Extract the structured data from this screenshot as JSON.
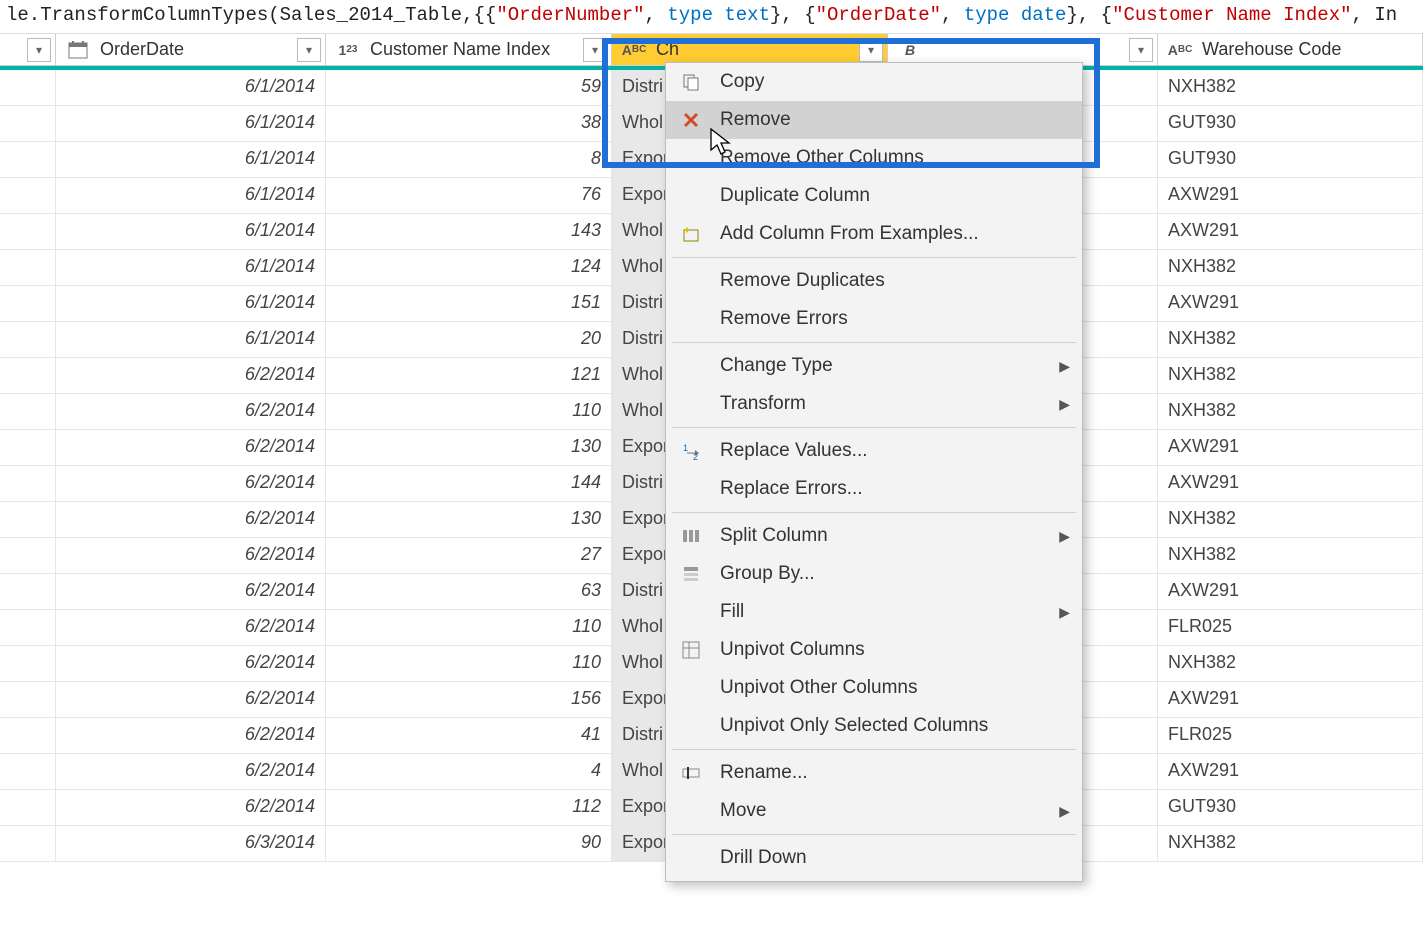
{
  "formula": {
    "prefix": "le.TransformColumnTypes(",
    "table": "Sales_2014_Table",
    "field1": "\"OrderNumber\"",
    "type_kw": "type",
    "type1": "text",
    "field2": "\"OrderDate\"",
    "type2": "date",
    "field3": "\"Customer Name Index\"",
    "tail": ", In"
  },
  "columns": [
    {
      "label": "",
      "type": "none"
    },
    {
      "label": "OrderDate",
      "type": "date"
    },
    {
      "label": "Customer Name Index",
      "type": "number"
    },
    {
      "label": "Ch",
      "type": "text",
      "selected": true
    },
    {
      "label": " ",
      "type": "text"
    },
    {
      "label": "Warehouse Code",
      "type": "text"
    }
  ],
  "rows": [
    {
      "date": "6/1/2014",
      "idx": 59,
      "ch": "Distri",
      "wh": "NXH382"
    },
    {
      "date": "6/1/2014",
      "idx": 38,
      "ch": "Whol",
      "wh": "GUT930"
    },
    {
      "date": "6/1/2014",
      "idx": 8,
      "ch": "Expor",
      "wh": "GUT930"
    },
    {
      "date": "6/1/2014",
      "idx": 76,
      "ch": "Expor",
      "wh": "AXW291"
    },
    {
      "date": "6/1/2014",
      "idx": 143,
      "ch": "Whol",
      "wh": "AXW291"
    },
    {
      "date": "6/1/2014",
      "idx": 124,
      "ch": "Whol",
      "wh": "NXH382"
    },
    {
      "date": "6/1/2014",
      "idx": 151,
      "ch": "Distri",
      "wh": "AXW291"
    },
    {
      "date": "6/1/2014",
      "idx": 20,
      "ch": "Distri",
      "wh": "NXH382"
    },
    {
      "date": "6/2/2014",
      "idx": 121,
      "ch": "Whol",
      "wh": "NXH382"
    },
    {
      "date": "6/2/2014",
      "idx": 110,
      "ch": "Whol",
      "wh": "NXH382"
    },
    {
      "date": "6/2/2014",
      "idx": 130,
      "ch": "Expor",
      "wh": "AXW291"
    },
    {
      "date": "6/2/2014",
      "idx": 144,
      "ch": "Distri",
      "wh": "AXW291"
    },
    {
      "date": "6/2/2014",
      "idx": 130,
      "ch": "Expor",
      "wh": "NXH382"
    },
    {
      "date": "6/2/2014",
      "idx": 27,
      "ch": "Expor",
      "wh": "NXH382"
    },
    {
      "date": "6/2/2014",
      "idx": 63,
      "ch": "Distri",
      "wh": "AXW291"
    },
    {
      "date": "6/2/2014",
      "idx": 110,
      "ch": "Whol",
      "wh": "FLR025"
    },
    {
      "date": "6/2/2014",
      "idx": 110,
      "ch": "Whol",
      "wh": "NXH382"
    },
    {
      "date": "6/2/2014",
      "idx": 156,
      "ch": "Expor",
      "wh": "AXW291"
    },
    {
      "date": "6/2/2014",
      "idx": 41,
      "ch": "Distri",
      "wh": "FLR025"
    },
    {
      "date": "6/2/2014",
      "idx": 4,
      "ch": "Whol",
      "wh": "AXW291"
    },
    {
      "date": "6/2/2014",
      "idx": 112,
      "ch": "Expor",
      "wh": "GUT930"
    },
    {
      "date": "6/3/2014",
      "idx": 90,
      "ch": "Expor",
      "wh": "NXH382"
    }
  ],
  "menu": [
    {
      "label": "Copy",
      "icon": "copy"
    },
    {
      "label": "Remove",
      "icon": "remove",
      "hovered": true
    },
    {
      "label": "Remove Other Columns"
    },
    {
      "label": "Duplicate Column"
    },
    {
      "label": "Add Column From Examples...",
      "icon": "sparkle"
    },
    {
      "sep": true
    },
    {
      "label": "Remove Duplicates"
    },
    {
      "label": "Remove Errors"
    },
    {
      "sep": true
    },
    {
      "label": "Change Type",
      "submenu": true
    },
    {
      "label": "Transform",
      "submenu": true
    },
    {
      "sep": true
    },
    {
      "label": "Replace Values...",
      "icon": "replace"
    },
    {
      "label": "Replace Errors..."
    },
    {
      "sep": true
    },
    {
      "label": "Split Column",
      "icon": "split",
      "submenu": true
    },
    {
      "label": "Group By...",
      "icon": "group"
    },
    {
      "label": "Fill",
      "submenu": true
    },
    {
      "label": "Unpivot Columns",
      "icon": "unpivot"
    },
    {
      "label": "Unpivot Other Columns"
    },
    {
      "label": "Unpivot Only Selected Columns"
    },
    {
      "sep": true
    },
    {
      "label": "Rename...",
      "icon": "rename"
    },
    {
      "label": "Move",
      "submenu": true
    },
    {
      "sep": true
    },
    {
      "label": "Drill Down"
    }
  ]
}
